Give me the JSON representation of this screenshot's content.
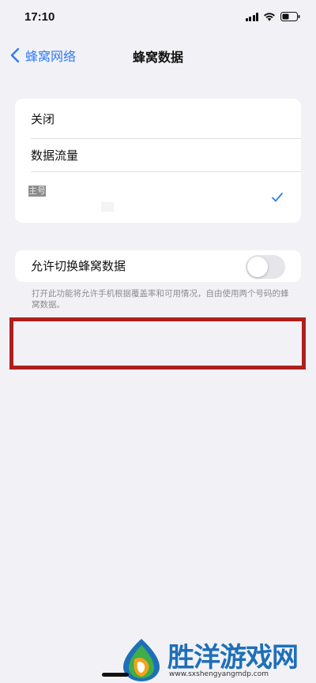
{
  "status_bar": {
    "time": "17:10"
  },
  "nav": {
    "back_label": "蜂窝网络",
    "title": "蜂窝数据"
  },
  "data_list": {
    "items": [
      {
        "label": "关闭",
        "selected": false
      },
      {
        "label": "数据流量",
        "selected": false
      },
      {
        "label": "主号",
        "selected": true
      }
    ]
  },
  "switch_section": {
    "label": "允许切换蜂窝数据",
    "enabled": false,
    "description": "打开此功能将允许手机根据覆盖率和可用情况，自由使用两个号码的蜂窝数据。"
  },
  "watermark": {
    "title": "胜洋游戏网",
    "url": "www.sxshengyangmdp.com"
  },
  "colors": {
    "accent": "#2f7bf6",
    "background": "#f2f2f6",
    "highlight_border": "#b11e1e",
    "watermark_blue": "#1f6fb8"
  }
}
